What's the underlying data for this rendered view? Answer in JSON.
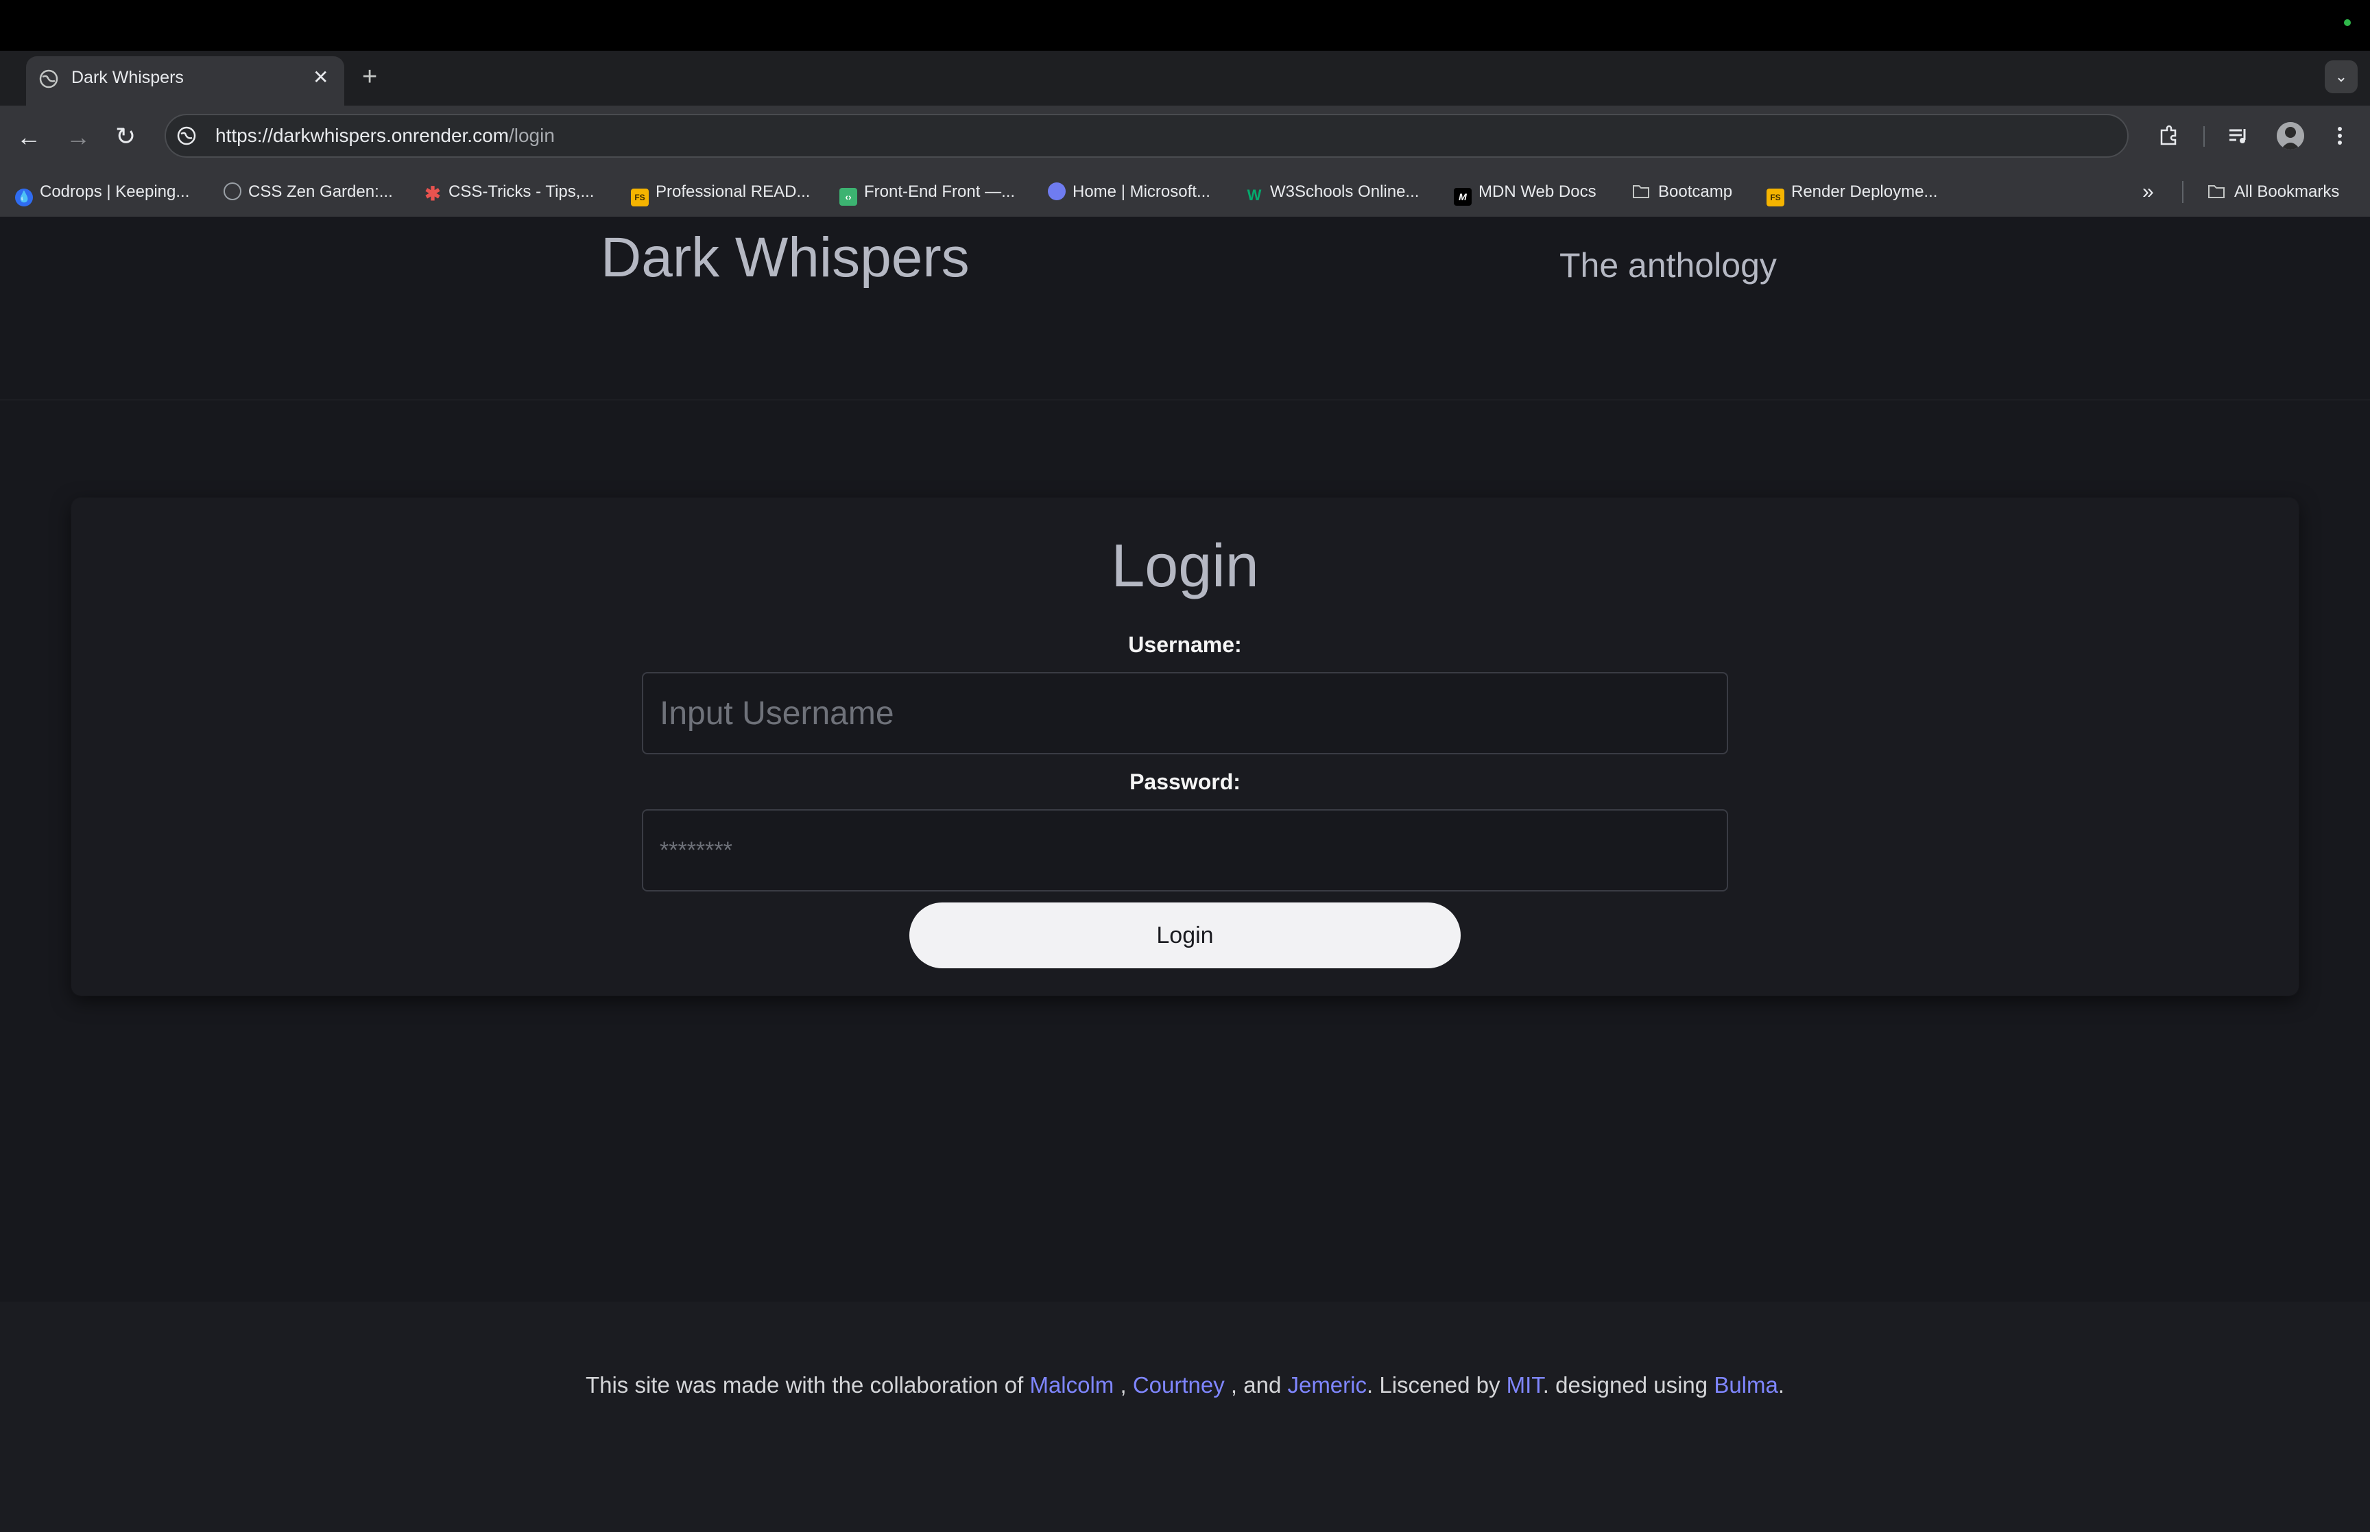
{
  "browser": {
    "tab": {
      "title": "Dark Whispers",
      "close": "✕"
    },
    "new_tab": "+",
    "tab_search": "⌄",
    "url": {
      "host": "https://darkwhispers.onrender.com",
      "path": "/login"
    },
    "bookmarks": [
      {
        "label": "Codrops | Keeping...",
        "icon": "codrops-icon",
        "color": "#2f6cf0"
      },
      {
        "label": "CSS Zen Garden:...",
        "icon": "globe-icon",
        "color": "#9aa0a6"
      },
      {
        "label": "CSS-Tricks - Tips,...",
        "icon": "asterisk-icon",
        "color": "#e8534f"
      },
      {
        "label": "Professional READ...",
        "icon": "fs-icon",
        "color": "#f5b400"
      },
      {
        "label": "Front-End Front —...",
        "icon": "code-icon",
        "color": "#3cb371"
      },
      {
        "label": "Home | Microsoft...",
        "icon": "microsoft-icon",
        "color": "#6f7cf0"
      },
      {
        "label": "W3Schools Online...",
        "icon": "w3schools-icon",
        "color": "#04aa6d"
      },
      {
        "label": "MDN Web Docs",
        "icon": "mdn-icon",
        "color": "#ffffff"
      },
      {
        "label": "Bootcamp",
        "icon": "folder-icon",
        "color": "#c4c7c5"
      },
      {
        "label": "Render Deployme...",
        "icon": "fs-icon",
        "color": "#f5b400"
      }
    ],
    "all_bookmarks": "All Bookmarks",
    "bookmarks_more": "»"
  },
  "header": {
    "title": "Dark Whispers",
    "subtitle": "The anthology"
  },
  "login": {
    "title": "Login",
    "username_label": "Username:",
    "username_placeholder": "Input Username",
    "password_label": "Password:",
    "password_placeholder": "********",
    "button": "Login"
  },
  "footer": {
    "prefix": "This site was made with the collaboration of ",
    "name1": "Malcolm",
    "sep1": " , ",
    "name2": "Courtney",
    "sep2": " , and ",
    "name3": "Jemeric",
    "mid": ". Liscened by ",
    "license": "MIT",
    "mid2": ". designed using ",
    "framework": "Bulma",
    "end": "."
  },
  "colors": {
    "page_bg": "#17181d",
    "heading": "#b5b8c3",
    "link": "#7f86ff",
    "button_bg": "#f2f2f4"
  }
}
